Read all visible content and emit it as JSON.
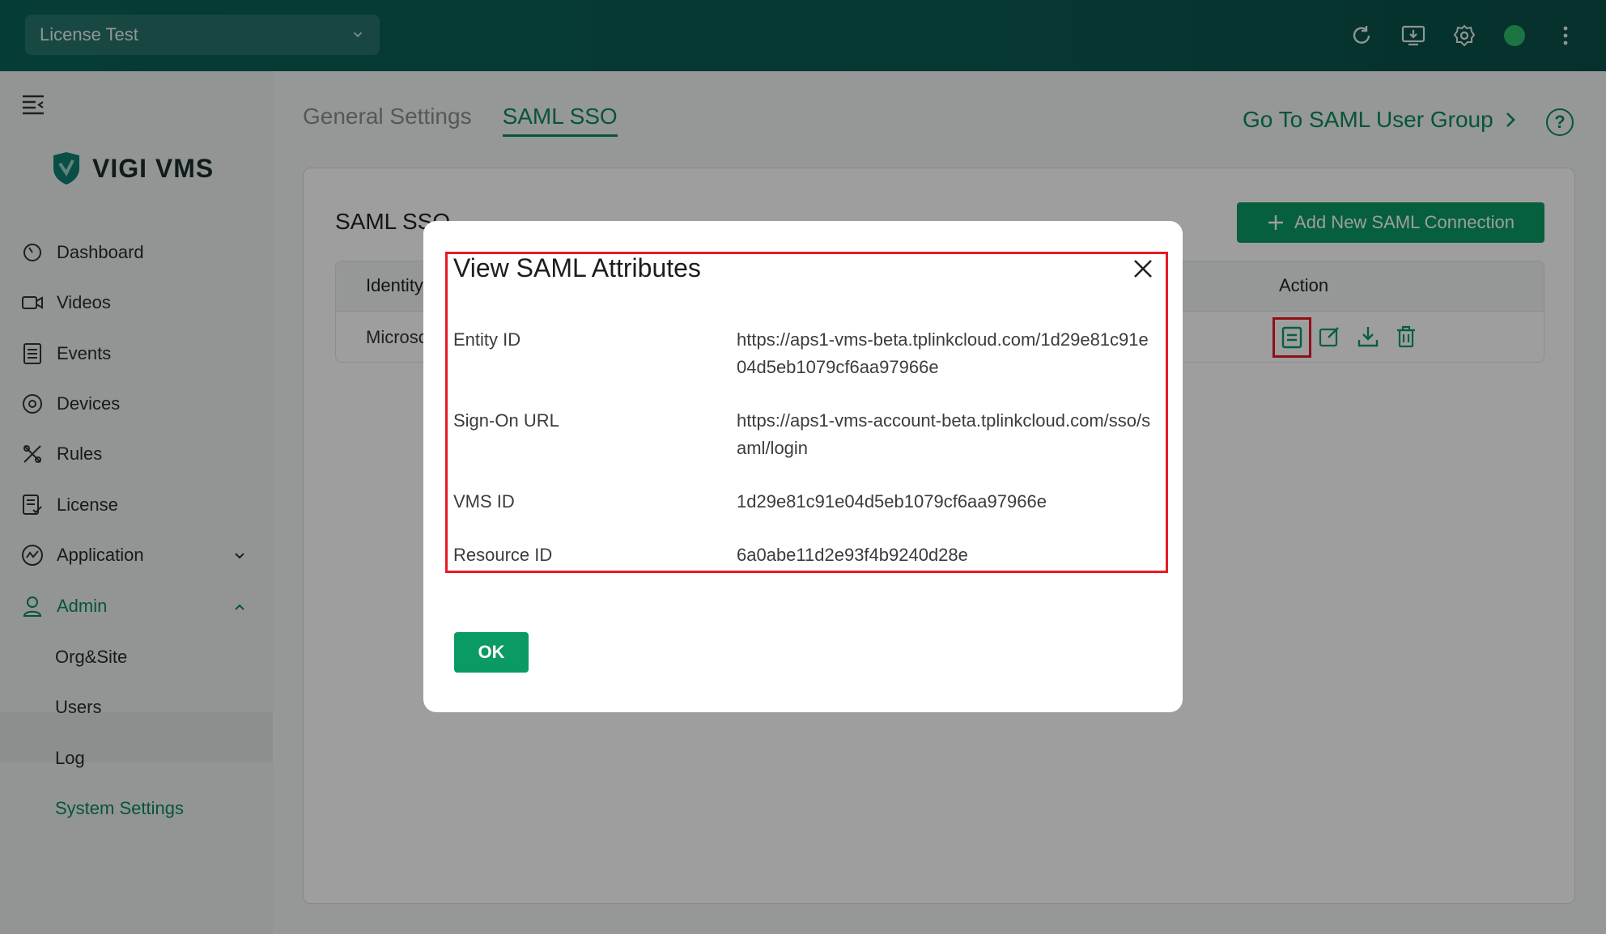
{
  "topbar": {
    "org_select_value": "License Test",
    "icons": [
      "refresh-icon",
      "download-client-icon",
      "settings-icon",
      "avatar-status-icon",
      "more-vertical-icon"
    ]
  },
  "sidebar": {
    "logo_text": "VIGI VMS",
    "items": [
      {
        "label": "Dashboard",
        "icon": "dashboard-icon"
      },
      {
        "label": "Videos",
        "icon": "video-icon"
      },
      {
        "label": "Events",
        "icon": "events-icon"
      },
      {
        "label": "Devices",
        "icon": "devices-icon"
      },
      {
        "label": "Rules",
        "icon": "rules-icon"
      },
      {
        "label": "License",
        "icon": "license-icon"
      },
      {
        "label": "Application",
        "icon": "application-icon"
      },
      {
        "label": "Admin",
        "icon": "admin-user-icon"
      }
    ],
    "admin_sub": [
      "Org&Site",
      "Users",
      "Log",
      "System Settings"
    ]
  },
  "main": {
    "tabs": [
      "General Settings",
      "SAML SSO"
    ],
    "goto_link": "Go To SAML User Group",
    "card_title": "SAML SSO",
    "add_button": "Add New SAML Connection",
    "table": {
      "headers": [
        "Identity",
        "Action"
      ],
      "row_identity": "Microsoft"
    }
  },
  "dialog": {
    "title": "View SAML Attributes",
    "attributes": [
      {
        "label": "Entity ID",
        "value": "https://aps1-vms-beta.tplinkcloud.com/1d29e81c91e04d5eb1079cf6aa97966e"
      },
      {
        "label": "Sign-On URL",
        "value": "https://aps1-vms-account-beta.tplinkcloud.com/sso/saml/login"
      },
      {
        "label": "VMS ID",
        "value": "1d29e81c91e04d5eb1079cf6aa97966e"
      },
      {
        "label": "Resource ID",
        "value": "6a0abe11d2e93f4b9240d28e"
      }
    ],
    "ok_button": "OK"
  },
  "colors": {
    "brand_green": "#0a9a63",
    "topbar": "#0b5e55",
    "highlight_red": "#e41c26"
  }
}
